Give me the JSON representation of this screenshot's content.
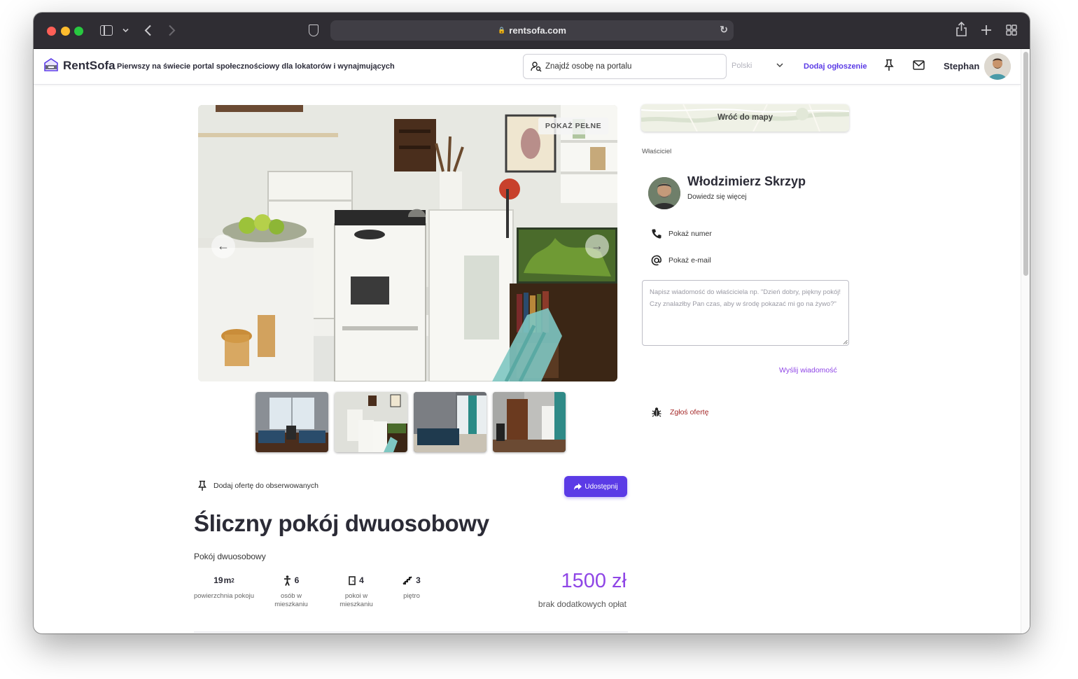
{
  "browser": {
    "url": "rentsofa.com",
    "icons": [
      "sidebar-icon",
      "chevron-down-icon",
      "back-icon",
      "forward-icon",
      "shield-icon",
      "lock-icon",
      "reload-icon",
      "share-icon",
      "new-tab-icon",
      "tab-overview-icon"
    ]
  },
  "header": {
    "brand": "RentSofa",
    "tagline": "Pierwszy na świecie portal społecznościowy dla lokatorów i wynajmujących",
    "search_placeholder": "Znajdź osobę na portalu",
    "language": "Polski",
    "add_listing": "Dodaj ogłoszenie",
    "username": "Stephan"
  },
  "gallery": {
    "show_full_label": "POKAŻ PEŁNE",
    "thumbnail_count": 4
  },
  "listing": {
    "watch_label": "Dodaj ofertę do obserwowanych",
    "share_label": "Udostępnij",
    "title": "Śliczny pokój dwuosobowy",
    "room_type": "Pokój dwuosobowy",
    "stats": [
      {
        "value": "19",
        "unit": "m",
        "sup": "2",
        "label": "powierzchnia pokoju",
        "icon": "area-icon"
      },
      {
        "value": "6",
        "label": "osób w mieszkaniu",
        "icon": "person-icon"
      },
      {
        "value": "4",
        "label": "pokoi w mieszkaniu",
        "icon": "door-icon"
      },
      {
        "value": "3",
        "label": "piętro",
        "icon": "stairs-icon"
      }
    ],
    "price": "1500 zł",
    "price_note": "brak dodatkowych opłat"
  },
  "sidebar": {
    "map_button": "Wróć do mapy",
    "owner_label": "Właściciel",
    "owner_name": "Włodzimierz Skrzyp",
    "owner_more": "Dowiedz się więcej",
    "show_phone": "Pokaż numer",
    "show_email": "Pokaż e-mail",
    "message_placeholder": "Napisz wiadomość do właściciela np. \"Dzień dobry, piękny pokój! Czy znalazłby Pan czas, aby w środę pokazać mi go na żywo?\"",
    "send_label": "Wyślij wiadomość",
    "report_label": "Zgłoś ofertę"
  },
  "colors": {
    "accent": "#5b3be6",
    "price": "#8f46e6",
    "report": "#a52a2a",
    "titlebar": "#2f2d33"
  }
}
